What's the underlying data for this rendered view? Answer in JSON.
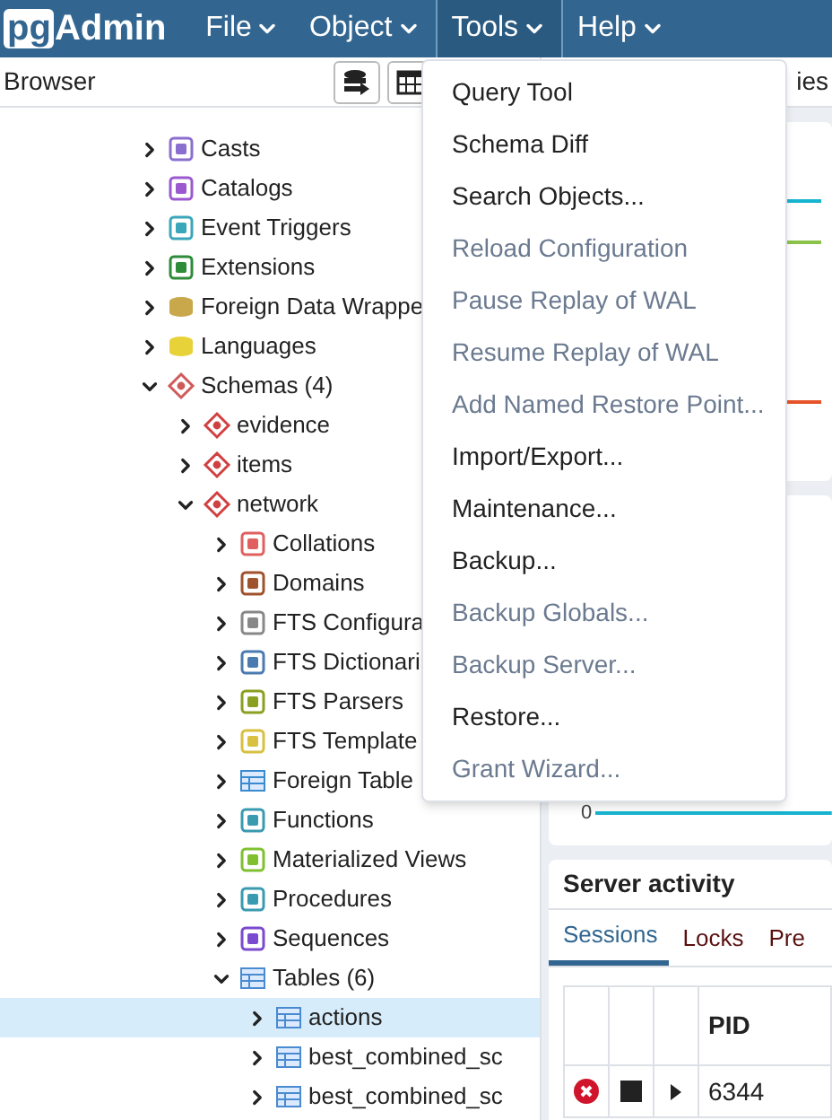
{
  "menubar": {
    "logo": {
      "boxed": "pg",
      "rest": "Admin"
    },
    "menus": [
      {
        "label": "File",
        "selected": false
      },
      {
        "label": "Object",
        "selected": false
      },
      {
        "label": "Tools",
        "selected": true
      },
      {
        "label": "Help",
        "selected": false
      }
    ]
  },
  "browser": {
    "title": "Browser",
    "tree": [
      {
        "label": "Casts",
        "kind": "cast",
        "expanded": false,
        "selected": false
      },
      {
        "label": "Catalogs",
        "kind": "catalog",
        "expanded": false,
        "selected": false
      },
      {
        "label": "Event Triggers",
        "kind": "trigger",
        "expanded": false,
        "selected": false
      },
      {
        "label": "Extensions",
        "kind": "extension",
        "expanded": false,
        "selected": false
      },
      {
        "label": "Foreign Data Wrappe",
        "kind": "fdw",
        "expanded": false,
        "selected": false
      },
      {
        "label": "Languages",
        "kind": "language",
        "expanded": false,
        "selected": false
      },
      {
        "label": "Schemas (4)",
        "kind": "schemas",
        "expanded": true,
        "selected": false,
        "children": [
          {
            "label": "evidence",
            "kind": "schema",
            "expanded": false,
            "selected": false
          },
          {
            "label": "items",
            "kind": "schema",
            "expanded": false,
            "selected": false
          },
          {
            "label": "network",
            "kind": "schema",
            "expanded": true,
            "selected": false,
            "children": [
              {
                "label": "Collations",
                "kind": "collation",
                "expanded": false,
                "selected": false
              },
              {
                "label": "Domains",
                "kind": "domain",
                "expanded": false,
                "selected": false
              },
              {
                "label": "FTS Configura",
                "kind": "fts",
                "expanded": false,
                "selected": false
              },
              {
                "label": "FTS Dictionari",
                "kind": "dictionary",
                "expanded": false,
                "selected": false
              },
              {
                "label": "FTS Parsers",
                "kind": "parser",
                "expanded": false,
                "selected": false
              },
              {
                "label": "FTS Template",
                "kind": "template",
                "expanded": false,
                "selected": false
              },
              {
                "label": "Foreign Table",
                "kind": "foreign-table",
                "expanded": false,
                "selected": false
              },
              {
                "label": "Functions",
                "kind": "function",
                "expanded": false,
                "selected": false
              },
              {
                "label": "Materialized Views",
                "kind": "matview",
                "expanded": false,
                "selected": false
              },
              {
                "label": "Procedures",
                "kind": "procedure",
                "expanded": false,
                "selected": false
              },
              {
                "label": "Sequences",
                "kind": "sequence",
                "expanded": false,
                "selected": false
              },
              {
                "label": "Tables (6)",
                "kind": "tables",
                "expanded": true,
                "selected": false,
                "children": [
                  {
                    "label": "actions",
                    "kind": "table",
                    "expanded": false,
                    "selected": true
                  },
                  {
                    "label": "best_combined_sc",
                    "kind": "table",
                    "expanded": false,
                    "selected": false
                  },
                  {
                    "label": "best_combined_sc",
                    "kind": "table",
                    "expanded": false,
                    "selected": false
                  }
                ]
              }
            ]
          }
        ]
      }
    ]
  },
  "right_panel": {
    "tab_fragment": "ies",
    "server_activity": {
      "title": "Server activity",
      "tabs": [
        {
          "label": "Sessions",
          "selected": true
        },
        {
          "label": "Locks",
          "selected": false
        },
        {
          "label": "Pre",
          "selected": false
        }
      ],
      "columns": [
        "PID"
      ],
      "rows": [
        {
          "pid": "6344"
        }
      ]
    },
    "axis_label": "0"
  },
  "tools_menu": [
    {
      "label": "Query Tool",
      "disabled": false
    },
    {
      "label": "Schema Diff",
      "disabled": false
    },
    {
      "label": "Search Objects...",
      "disabled": false
    },
    {
      "label": "Reload Configuration",
      "disabled": true
    },
    {
      "label": "Pause Replay of WAL",
      "disabled": true
    },
    {
      "label": "Resume Replay of WAL",
      "disabled": true
    },
    {
      "label": "Add Named Restore Point...",
      "disabled": true
    },
    {
      "label": "Import/Export...",
      "disabled": false
    },
    {
      "label": "Maintenance...",
      "disabled": false
    },
    {
      "label": "Backup...",
      "disabled": false
    },
    {
      "label": "Backup Globals...",
      "disabled": true
    },
    {
      "label": "Backup Server...",
      "disabled": true
    },
    {
      "label": "Restore...",
      "disabled": false
    },
    {
      "label": "Grant Wizard...",
      "disabled": true
    }
  ]
}
